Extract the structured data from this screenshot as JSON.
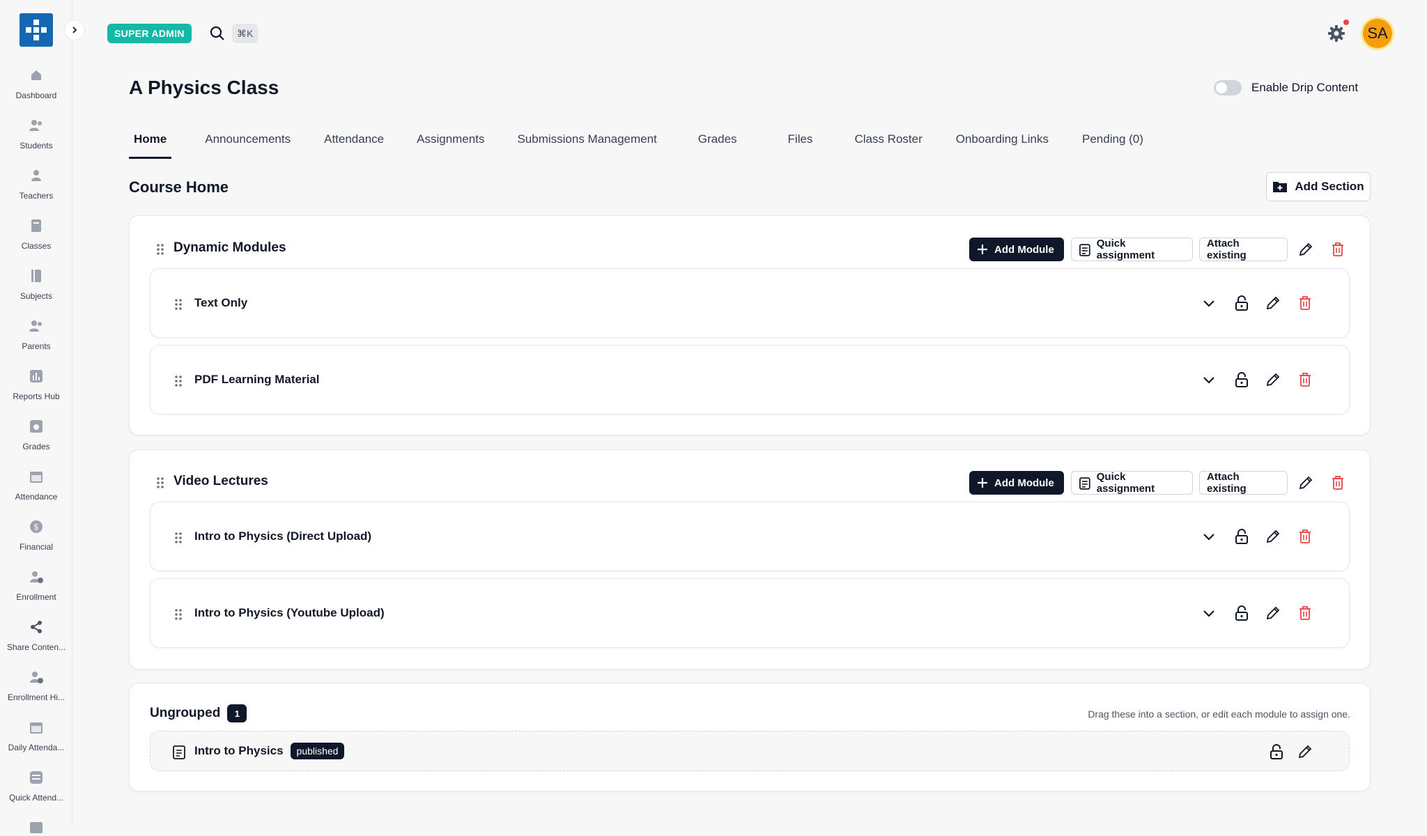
{
  "sidebar": {
    "items": [
      {
        "label": "Dashboard",
        "icon": "home-icon"
      },
      {
        "label": "Students",
        "icon": "users-icon"
      },
      {
        "label": "Teachers",
        "icon": "user-icon"
      },
      {
        "label": "Classes",
        "icon": "book-icon"
      },
      {
        "label": "Subjects",
        "icon": "notebook-icon"
      },
      {
        "label": "Parents",
        "icon": "users-icon"
      },
      {
        "label": "Reports Hub",
        "icon": "bar-chart-icon"
      },
      {
        "label": "Grades",
        "icon": "grade-icon"
      },
      {
        "label": "Attendance",
        "icon": "calendar-icon"
      },
      {
        "label": "Financial",
        "icon": "dollar-icon"
      },
      {
        "label": "Enrollment",
        "icon": "user-plus-icon"
      },
      {
        "label": "Share Conten...",
        "icon": "share-icon"
      },
      {
        "label": "Enrollment Hi...",
        "icon": "user-history-icon"
      },
      {
        "label": "Daily Attenda...",
        "icon": "calendar-icon"
      },
      {
        "label": "Quick Attend...",
        "icon": "quick-attendance-icon"
      }
    ]
  },
  "topbar": {
    "role_badge": "SUPER ADMIN",
    "shortcut": "⌘K",
    "avatar_initials": "SA"
  },
  "page": {
    "title": "A Physics Class",
    "drip_label": "Enable Drip Content",
    "drip_enabled": false
  },
  "tabs": [
    {
      "label": "Home",
      "active": true
    },
    {
      "label": "Announcements"
    },
    {
      "label": "Attendance"
    },
    {
      "label": "Assignments"
    },
    {
      "label": "Submissions Management"
    },
    {
      "label": "Grades"
    },
    {
      "label": "Files"
    },
    {
      "label": "Class Roster"
    },
    {
      "label": "Onboarding Links"
    },
    {
      "label": "Pending (0)"
    }
  ],
  "course_home": {
    "title": "Course Home",
    "add_section_label": "Add Section"
  },
  "section_actions": {
    "add_module": "Add Module",
    "quick_assignment": "Quick assignment",
    "attach_existing": "Attach existing"
  },
  "sections": [
    {
      "title": "Dynamic Modules",
      "modules": [
        "Text Only",
        "PDF Learning Material"
      ]
    },
    {
      "title": "Video Lectures",
      "modules": [
        "Intro to Physics (Direct Upload)",
        "Intro to Physics (Youtube Upload)"
      ]
    }
  ],
  "ungrouped": {
    "title": "Ungrouped",
    "count": "1",
    "hint": "Drag these into a section, or edit each module to assign one.",
    "item_title": "Intro to Physics",
    "item_status": "published"
  },
  "colors": {
    "brand": "#1467b3",
    "accent_teal": "#14b8a6",
    "dark": "#0f172a",
    "danger": "#ef4444",
    "avatar": "#f59e0b"
  }
}
